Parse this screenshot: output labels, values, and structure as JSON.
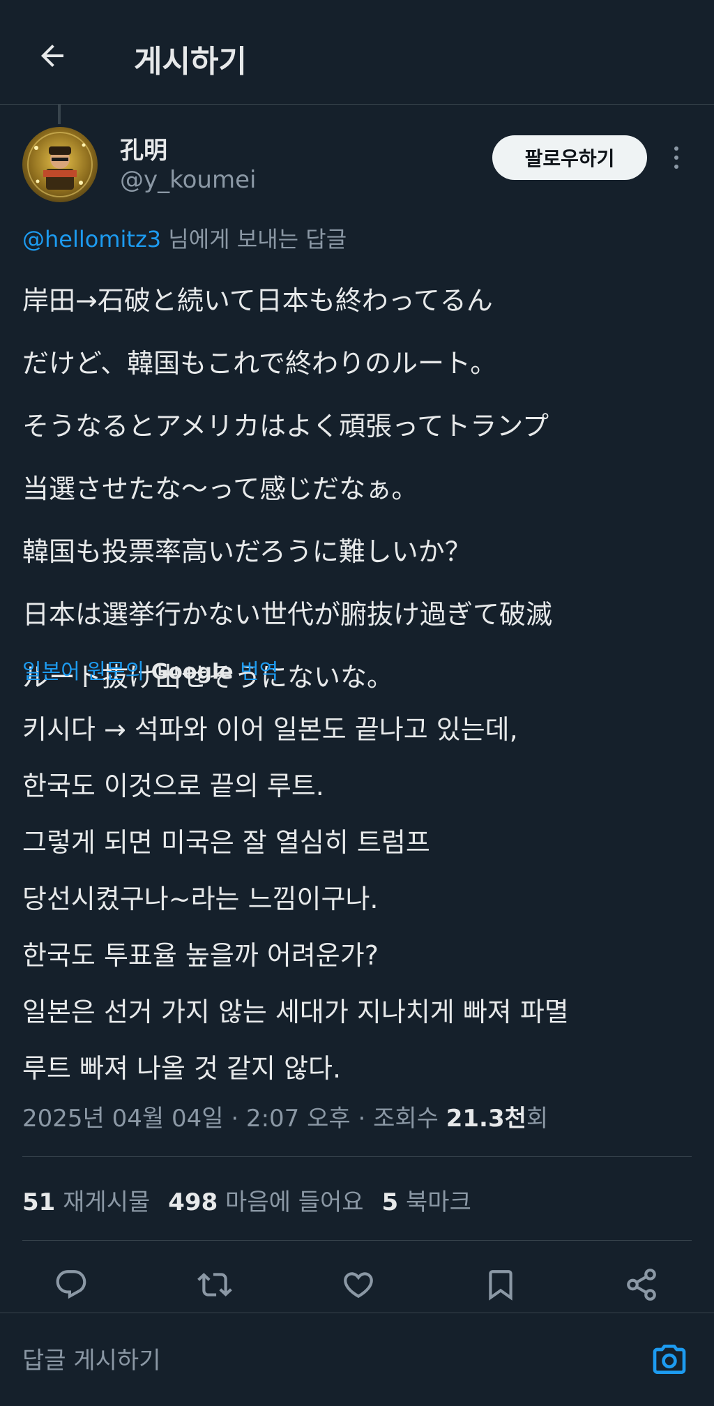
{
  "header": {
    "title": "게시하기"
  },
  "author": {
    "name": "孔明",
    "handle": "@y_koumei",
    "follow_label": "팔로우하기"
  },
  "reply_to": {
    "mention": "@hellomitz3",
    "suffix": " 님에게 보내는 답글"
  },
  "tweet": {
    "lines": [
      "岸田→石破と続いて日本も終わってるん",
      "だけど、韓国もこれで終わりのルート。",
      "そうなるとアメリカはよく頑張ってトランプ",
      "当選させたな〜って感じだなぁ。",
      "韓国も投票率高いだろうに難しいか？",
      "日本は選挙行かない世代が腑抜け過ぎて破滅",
      "ルート抜け出せそうにないな。"
    ]
  },
  "translation": {
    "prefix": "일본어 원문의 ",
    "provider": "Google",
    "suffix": " 번역",
    "lines": [
      "키시다 → 석파와 이어 일본도 끝나고 있는데,",
      "한국도 이것으로 끝의 루트.",
      "그렇게 되면 미국은 잘 열심히 트럼프",
      "당선시켰구나~라는 느낌이구나.",
      "한국도 투표율 높을까 어려운가?",
      "일본은 선거 가지 않는 세대가 지나치게 빠져 파멸",
      "루트 빠져 나올 것 같지 않다."
    ]
  },
  "timestamp": {
    "text": "2025년 04월 04일 · 2:07 오후 · 조회수 ",
    "views": "21.3천",
    "views_suffix": "회"
  },
  "stats": {
    "reposts_count": "51",
    "reposts_label": " 재게시물",
    "likes_count": "498",
    "likes_label": " 마음에 들어요",
    "bookmarks_count": "5",
    "bookmarks_label": " 북마크"
  },
  "actions": [
    "reply-icon",
    "repost-icon",
    "like-icon",
    "bookmark-icon",
    "share-icon"
  ],
  "reply_bar": {
    "placeholder": "답글 게시하기"
  },
  "colors": {
    "background": "#15202b",
    "accent": "#1d9bf0",
    "text": "#e7e9ea",
    "secondary_text": "#8b98a5",
    "divider": "#38444d"
  }
}
